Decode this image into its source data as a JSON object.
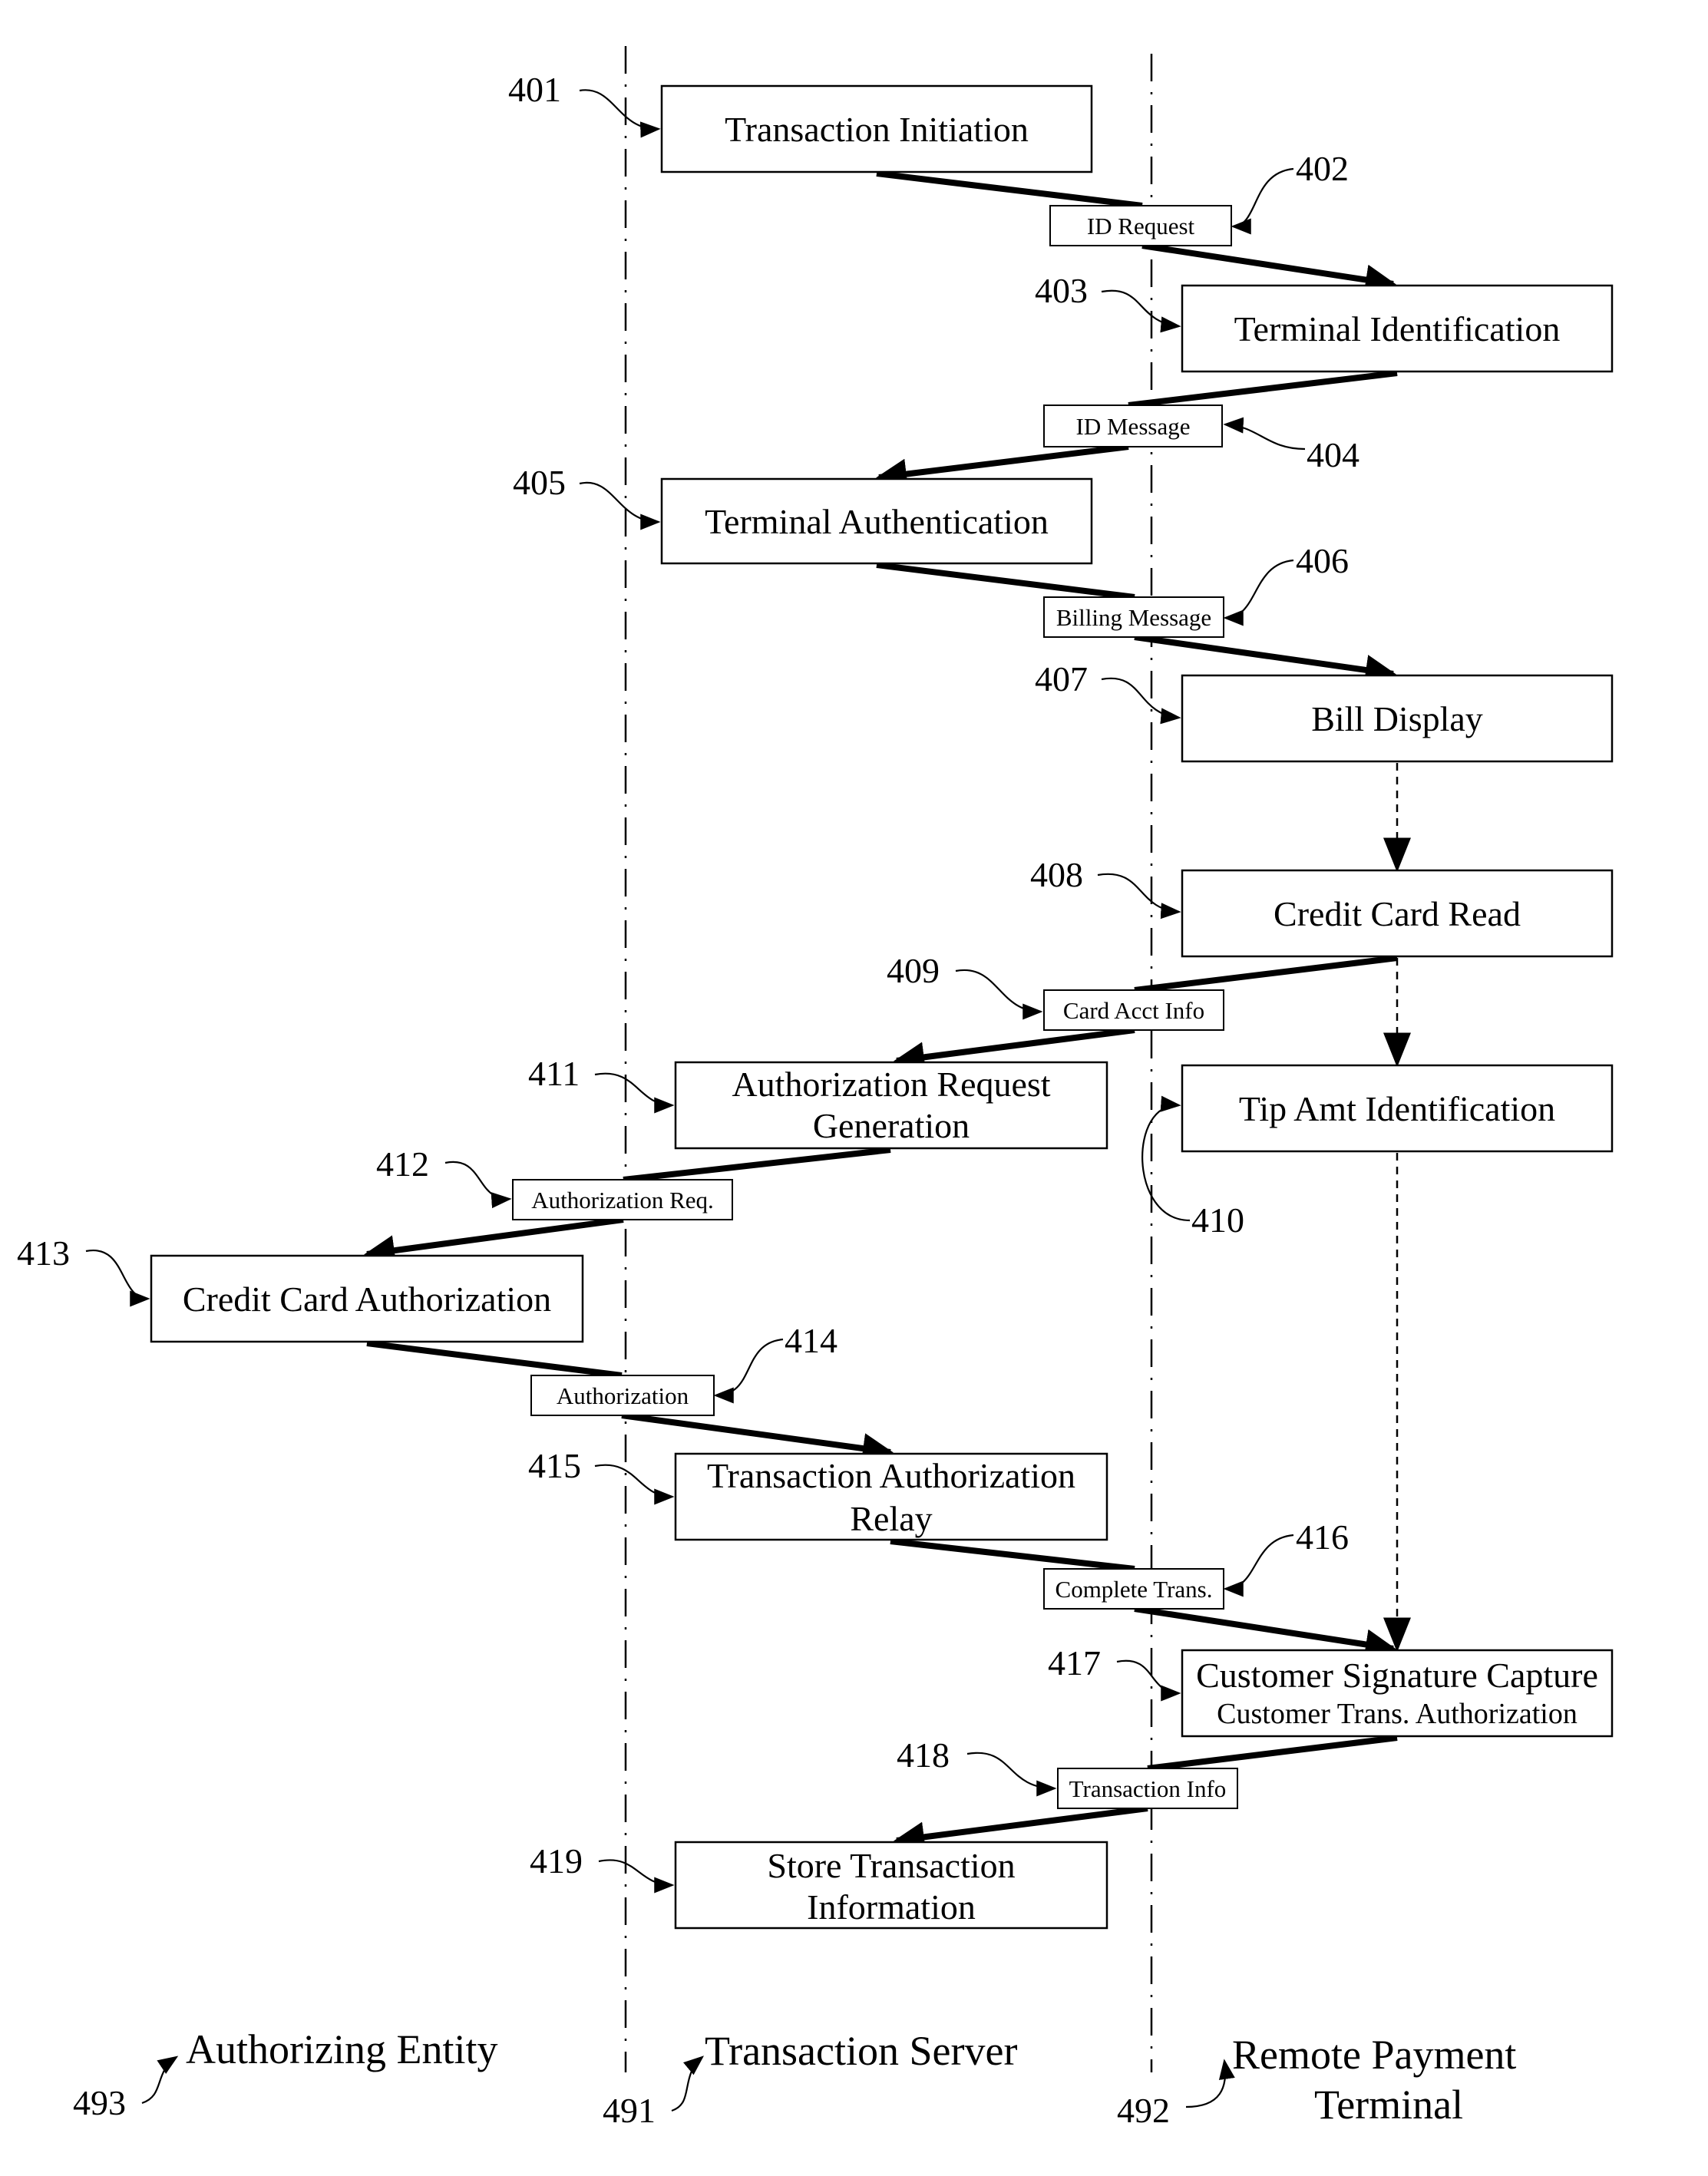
{
  "figure": {
    "lanes": [
      {
        "ref": "493",
        "label": "Authorizing Entity"
      },
      {
        "ref": "491",
        "label": "Transaction Server"
      },
      {
        "ref": "492",
        "label_line1": "Remote Payment",
        "label_line2": "Terminal"
      }
    ],
    "steps": [
      {
        "ref": "401",
        "lines": [
          "Transaction Initiation"
        ]
      },
      {
        "ref": "403",
        "lines": [
          "Terminal Identification"
        ]
      },
      {
        "ref": "405",
        "lines": [
          "Terminal Authentication"
        ]
      },
      {
        "ref": "407",
        "lines": [
          "Bill Display"
        ]
      },
      {
        "ref": "408",
        "lines": [
          "Credit Card Read"
        ]
      },
      {
        "ref": "410",
        "lines": [
          "Tip Amt Identification"
        ]
      },
      {
        "ref": "411",
        "lines": [
          "Authorization Request",
          "Generation"
        ]
      },
      {
        "ref": "413",
        "lines": [
          "Credit Card Authorization"
        ]
      },
      {
        "ref": "415",
        "lines": [
          "Transaction Authorization",
          "Relay"
        ]
      },
      {
        "ref": "417",
        "lines": [
          "Customer Signature Capture",
          "Customer Trans. Authorization"
        ]
      },
      {
        "ref": "419",
        "lines": [
          "Store Transaction",
          "Information"
        ]
      }
    ],
    "messages": [
      {
        "ref": "402",
        "label": "ID Request"
      },
      {
        "ref": "404",
        "label": "ID Message"
      },
      {
        "ref": "406",
        "label": "Billing Message"
      },
      {
        "ref": "409",
        "label": "Card Acct Info"
      },
      {
        "ref": "412",
        "label": "Authorization Req."
      },
      {
        "ref": "414",
        "label": "Authorization"
      },
      {
        "ref": "416",
        "label": "Complete Trans."
      },
      {
        "ref": "418",
        "label": "Transaction Info"
      }
    ]
  }
}
